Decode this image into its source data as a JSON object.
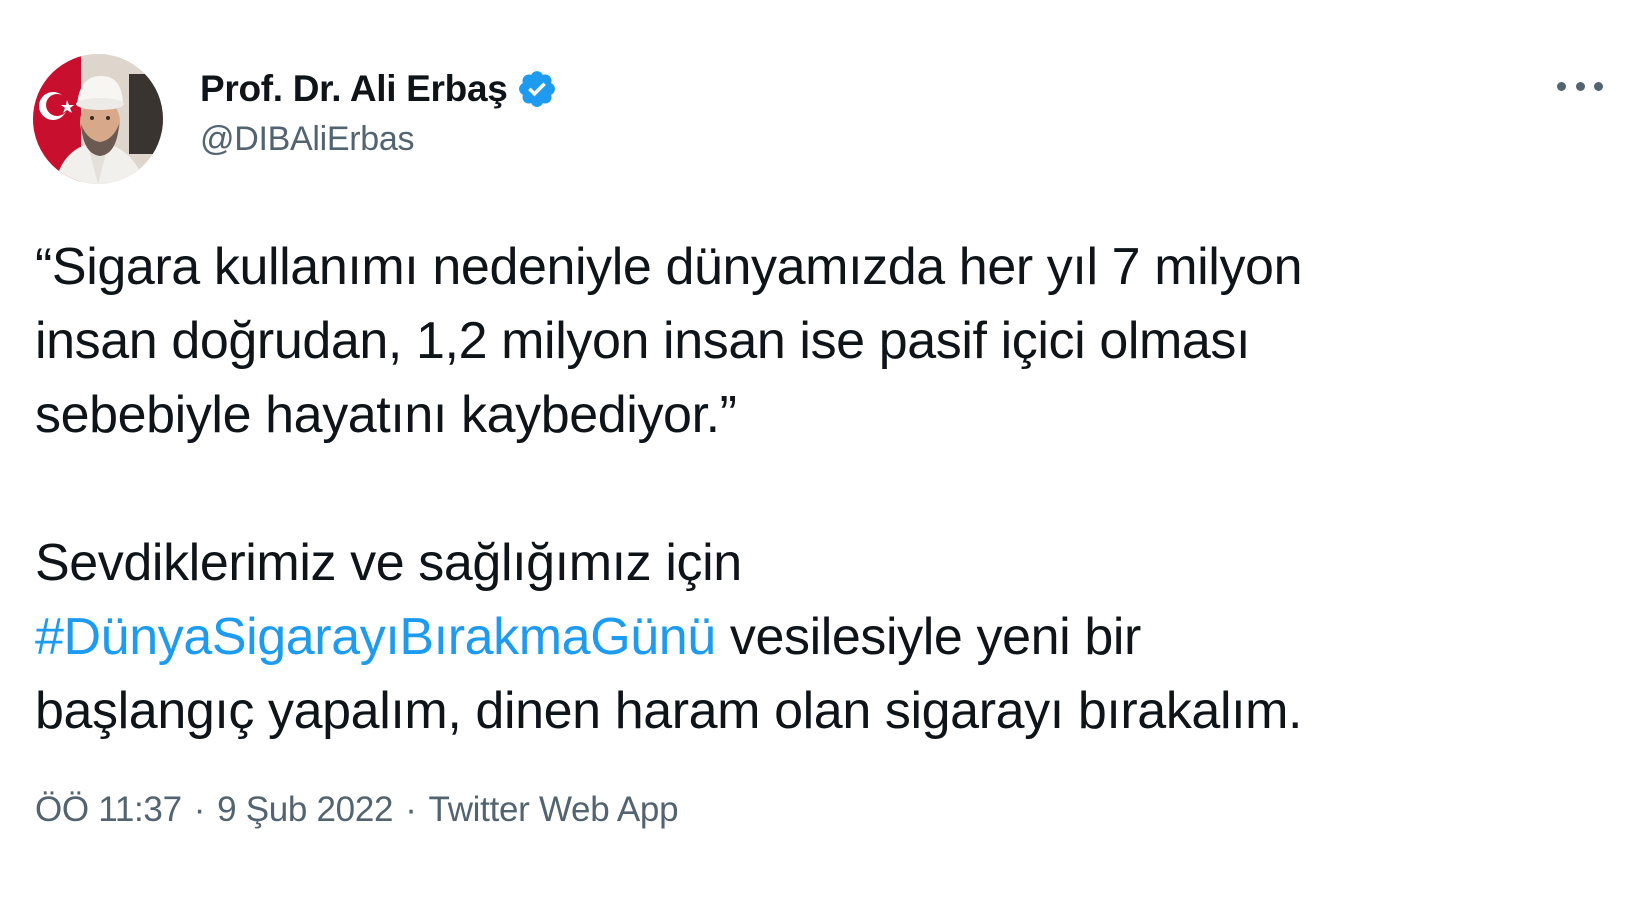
{
  "author": {
    "display_name": "Prof. Dr. Ali Erbaş",
    "handle": "@DIBAliErbas",
    "verified": true,
    "verified_color": "#1d9bf0"
  },
  "tweet": {
    "line1": "“Sigara kullanımı nedeniyle dünyamızda her yıl 7 milyon",
    "line2": "insan doğrudan, 1,2 milyon insan ise pasif içici olması",
    "line3": "sebebiyle hayatını kaybediyor.”",
    "line4": "Sevdiklerimiz ve sağlığımız için",
    "hashtag": "#DünyaSigarayıBırakmaGünü",
    "line5_rest": " vesilesiyle yeni bir",
    "line6": "başlangıç yapalım, dinen haram olan sigarayı bırakalım.",
    "hashtag_color": "#1d9bf0"
  },
  "meta": {
    "time": "ÖÖ 11:37",
    "separator": "·",
    "date": "9 Şub 2022",
    "source": "Twitter Web App"
  },
  "icons": {
    "avatar": "profile-photo",
    "verified": "verified-badge-icon",
    "more": "more-options-icon"
  }
}
